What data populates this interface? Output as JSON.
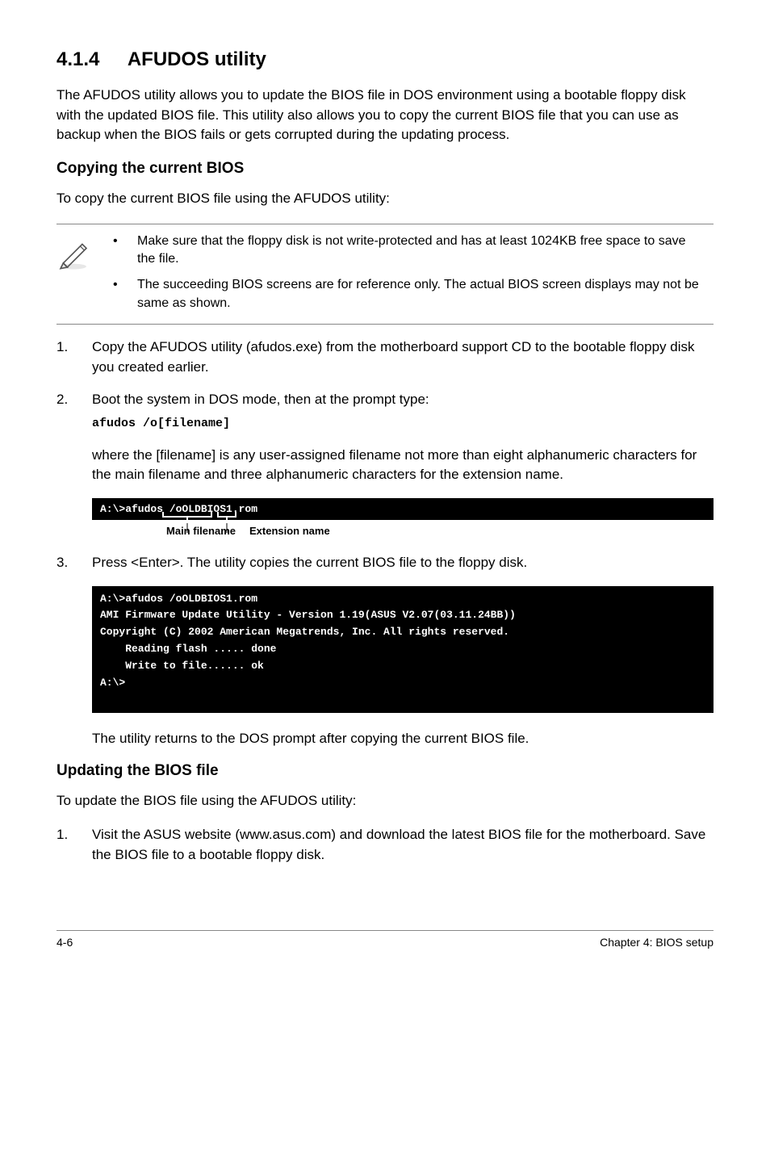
{
  "heading": {
    "number": "4.1.4",
    "title": "AFUDOS utility"
  },
  "intro": "The AFUDOS utility allows you to update the BIOS file in DOS environment using a bootable floppy disk with the updated BIOS file. This utility also allows you to copy the current BIOS file that you can use as backup when the BIOS fails or gets corrupted during the updating process.",
  "copy_section": {
    "title": "Copying the current BIOS",
    "intro": "To copy the current BIOS file using the AFUDOS utility:",
    "notes": [
      "Make sure that the floppy disk is not write-protected and has at least 1024KB free space to save the file.",
      "The succeeding BIOS screens are for reference only. The actual BIOS screen displays may not be same as shown."
    ],
    "steps": [
      {
        "num": "1.",
        "text": "Copy the AFUDOS utility (afudos.exe) from the motherboard support CD to the bootable floppy disk you created earlier."
      },
      {
        "num": "2.",
        "text": "Boot the system in DOS mode, then at the prompt type:",
        "code": "afudos /o[filename]",
        "sub": "where the [filename] is any user-assigned filename not more than eight alphanumeric characters  for the main filename and three alphanumeric characters for the extension name."
      }
    ],
    "code_box1": "A:\\>afudos /oOLDBIOS1.rom",
    "labels": {
      "main": "Main filename",
      "ext": "Extension name"
    },
    "step3": {
      "num": "3.",
      "text": "Press <Enter>. The utility copies the current BIOS file to the floppy disk."
    },
    "code_box2": "A:\\>afudos /oOLDBIOS1.rom\nAMI Firmware Update Utility - Version 1.19(ASUS V2.07(03.11.24BB))\nCopyright (C) 2002 American Megatrends, Inc. All rights reserved.\n    Reading flash ..... done\n    Write to file...... ok\nA:\\>\n ",
    "after": "The utility returns to the DOS prompt after copying the current BIOS file."
  },
  "update_section": {
    "title": "Updating the BIOS file",
    "intro": "To update the BIOS file using the AFUDOS utility:",
    "step1": {
      "num": "1.",
      "text": "Visit the ASUS website (www.asus.com) and download the latest BIOS file for the motherboard. Save the BIOS file to a bootable floppy disk."
    }
  },
  "footer": {
    "left": "4-6",
    "right": "Chapter 4: BIOS setup"
  }
}
